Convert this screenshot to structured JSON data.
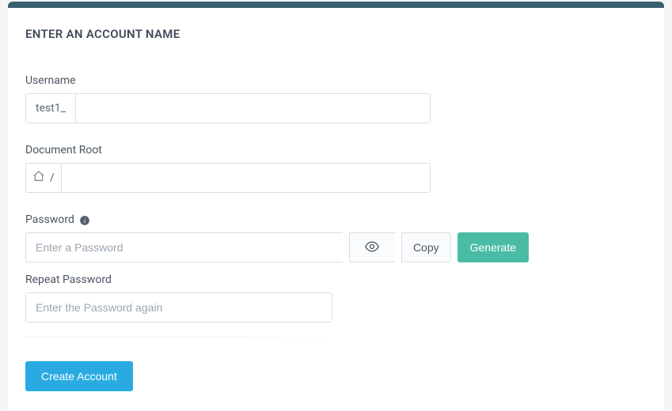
{
  "section": {
    "title": "ENTER AN ACCOUNT NAME"
  },
  "username": {
    "label": "Username",
    "prefix": "test1_",
    "value": ""
  },
  "document_root": {
    "label": "Document Root",
    "path_separator": "/",
    "value": ""
  },
  "password": {
    "label": "Password",
    "placeholder": "Enter a Password",
    "copy_label": "Copy",
    "generate_label": "Generate"
  },
  "repeat_password": {
    "label": "Repeat Password",
    "placeholder": "Enter the Password again"
  },
  "submit": {
    "label": "Create Account"
  }
}
